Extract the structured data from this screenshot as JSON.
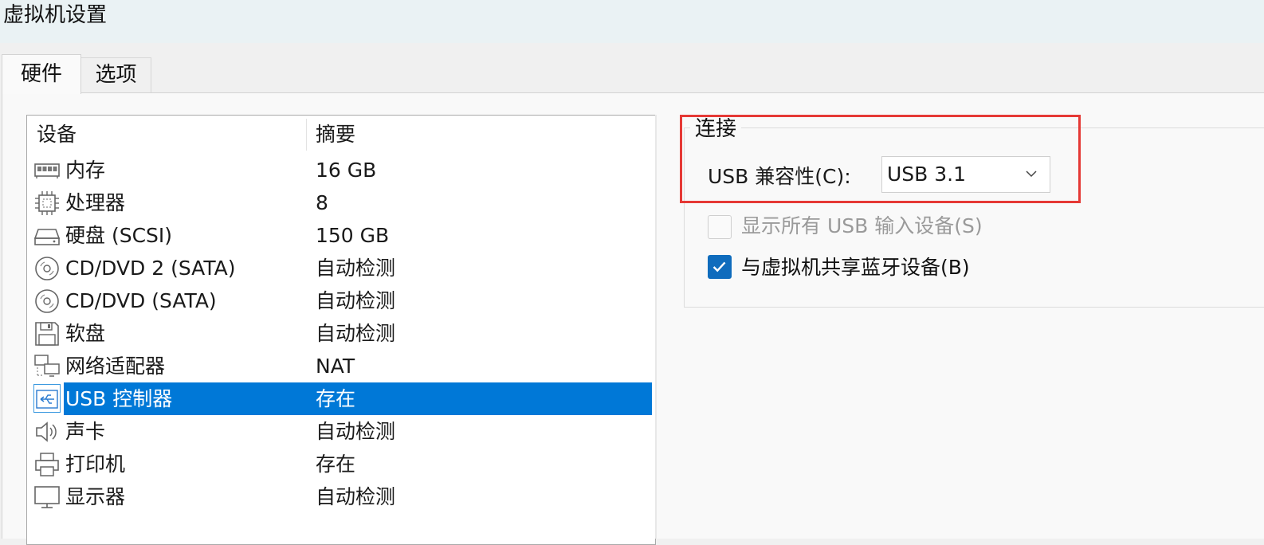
{
  "window": {
    "title": "虚拟机设置"
  },
  "tabs": [
    {
      "label": "硬件",
      "active": true
    },
    {
      "label": "选项",
      "active": false
    }
  ],
  "device_list": {
    "columns": {
      "device": "设备",
      "summary": "摘要"
    },
    "rows": [
      {
        "name": "内存",
        "summary": "16 GB",
        "icon": "memory-icon"
      },
      {
        "name": "处理器",
        "summary": "8",
        "icon": "cpu-icon"
      },
      {
        "name": "硬盘 (SCSI)",
        "summary": "150 GB",
        "icon": "hard-disk-icon"
      },
      {
        "name": "CD/DVD 2 (SATA)",
        "summary": "自动检测",
        "icon": "cd-dvd-icon"
      },
      {
        "name": "CD/DVD (SATA)",
        "summary": "自动检测",
        "icon": "cd-dvd-icon"
      },
      {
        "name": "软盘",
        "summary": "自动检测",
        "icon": "floppy-icon"
      },
      {
        "name": "网络适配器",
        "summary": "NAT",
        "icon": "network-adapter-icon"
      },
      {
        "name": "USB 控制器",
        "summary": "存在",
        "icon": "usb-icon",
        "selected": true
      },
      {
        "name": "声卡",
        "summary": "自动检测",
        "icon": "speaker-icon"
      },
      {
        "name": "打印机",
        "summary": "存在",
        "icon": "printer-icon"
      },
      {
        "name": "显示器",
        "summary": "自动检测",
        "icon": "monitor-icon"
      }
    ]
  },
  "connection": {
    "group_title": "连接",
    "usb_compat_label": "USB 兼容性(C):",
    "usb_compat_value": "USB 3.1",
    "show_all_usb_label": "显示所有 USB 输入设备(S)",
    "show_all_usb_checked": false,
    "show_all_usb_enabled": false,
    "share_bluetooth_label": "与虚拟机共享蓝牙设备(B)",
    "share_bluetooth_checked": true
  },
  "colors": {
    "selection": "#0078d7",
    "checkbox_checked": "#0f6cbd",
    "annotation_box": "#e53935"
  }
}
